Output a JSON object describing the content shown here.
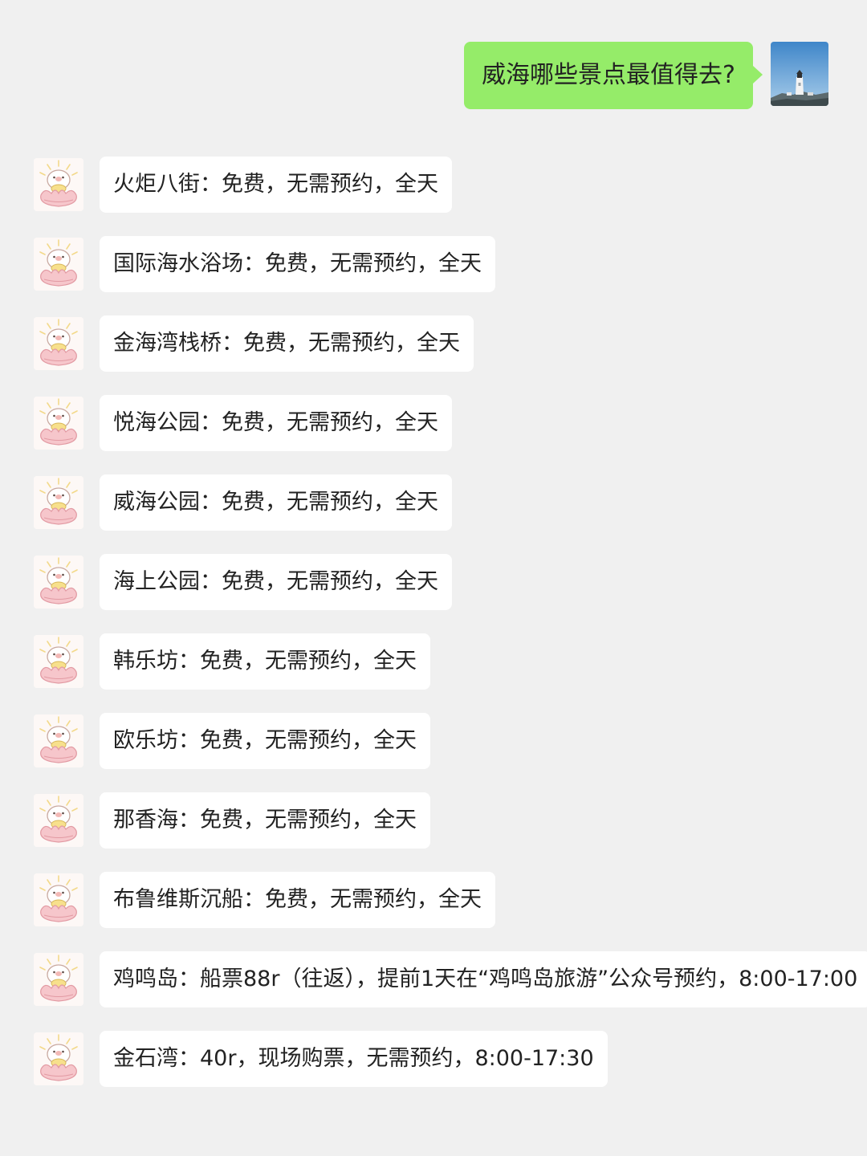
{
  "outgoing": {
    "text": "威海哪些景点最值得去?",
    "avatar_icon": "lighthouse-avatar"
  },
  "incoming": [
    {
      "text": "火炬八街：免费，无需预约，全天"
    },
    {
      "text": "国际海水浴场：免费，无需预约，全天"
    },
    {
      "text": "金海湾栈桥：免费，无需预约，全天"
    },
    {
      "text": "悦海公园：免费，无需预约，全天"
    },
    {
      "text": "威海公园：免费，无需预约，全天"
    },
    {
      "text": "海上公园：免费，无需预约，全天"
    },
    {
      "text": "韩乐坊：免费，无需预约，全天"
    },
    {
      "text": "欧乐坊：免费，无需预约，全天"
    },
    {
      "text": "那香海：免费，无需预约，全天"
    },
    {
      "text": "布鲁维斯沉船：免费，无需预约，全天"
    },
    {
      "text": "鸡鸣岛：船票88r（往返），提前1天在“鸡鸣岛旅游”公众号预约，8:00-17:00"
    },
    {
      "text": "金石湾：40r，现场购票，无需预约，8:00-17:30"
    }
  ],
  "bot_avatar_icon": "cartoon-avatar",
  "colors": {
    "background": "#f0f0f0",
    "outgoing_bubble": "#95ec69",
    "incoming_bubble": "#ffffff"
  }
}
